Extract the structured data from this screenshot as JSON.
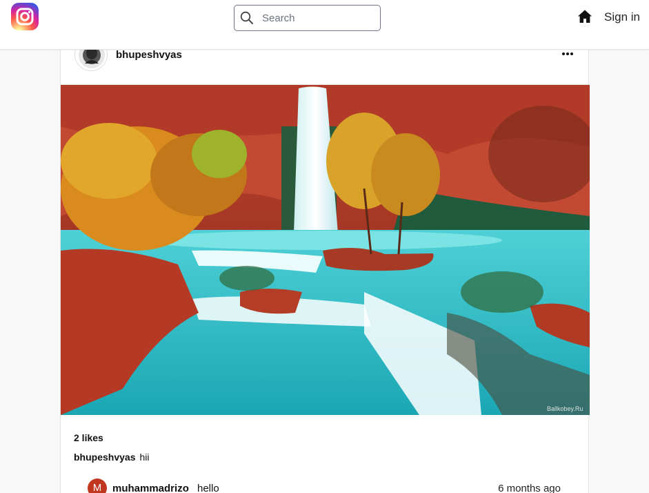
{
  "header": {
    "logo_icon": "instagram-logo",
    "search": {
      "placeholder": "Search",
      "value": ""
    },
    "home_icon": "home-icon",
    "sign_in_label": "Sign in"
  },
  "post": {
    "username": "bhupeshvyas",
    "more_icon": "more-horizontal-icon",
    "image_watermark": "Ballkobey.Ru",
    "likes_text": "2 likes",
    "caption": {
      "username": "bhupeshvyas",
      "text": "hii"
    },
    "comments": [
      {
        "avatar_letter": "M",
        "username": "muhammadrizo",
        "text": "hello",
        "time": "6 months ago"
      }
    ]
  },
  "colors": {
    "page_bg": "#f8f8f9",
    "comment_avatar_bg": "#c0361f",
    "search_border": "#6b7280"
  }
}
